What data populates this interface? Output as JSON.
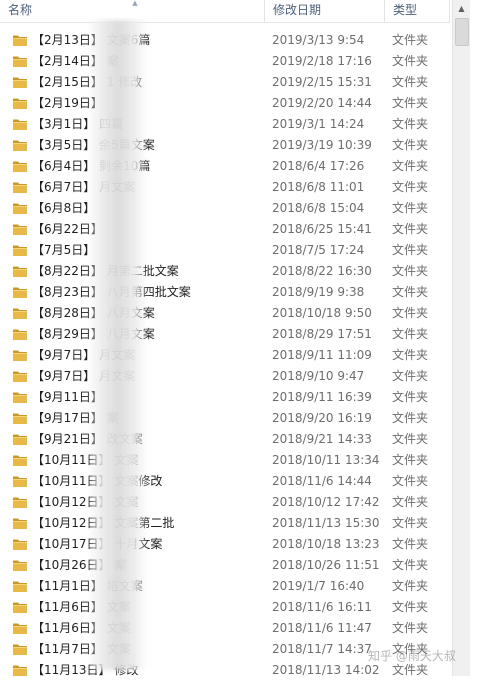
{
  "columns": {
    "name": "名称",
    "date": "修改日期",
    "type": "类型"
  },
  "rows": [
    {
      "name": "【2月13日】 文案6篇",
      "date": "2019/3/13 9:54",
      "type": "文件夹"
    },
    {
      "name": "【2月14日】 案",
      "date": "2019/2/18 17:16",
      "type": "文件夹"
    },
    {
      "name": "【2月15日】 1 修改",
      "date": "2019/2/15 15:31",
      "type": "文件夹"
    },
    {
      "name": "【2月19日】",
      "date": "2019/2/20 14:44",
      "type": "文件夹"
    },
    {
      "name": "【3月1日】 四篇",
      "date": "2019/3/1 14:24",
      "type": "文件夹"
    },
    {
      "name": "【3月5日】 余5篇文案",
      "date": "2019/3/19 10:39",
      "type": "文件夹"
    },
    {
      "name": "【6月4日】 剩余10篇",
      "date": "2018/6/4 17:26",
      "type": "文件夹"
    },
    {
      "name": "【6月7日】 月文案",
      "date": "2018/6/8 11:01",
      "type": "文件夹"
    },
    {
      "name": "【6月8日】",
      "date": "2018/6/8 15:04",
      "type": "文件夹"
    },
    {
      "name": "【6月22日】",
      "date": "2018/6/25 15:41",
      "type": "文件夹"
    },
    {
      "name": "【7月5日】",
      "date": "2018/7/5 17:24",
      "type": "文件夹"
    },
    {
      "name": "【8月22日】 月第二批文案",
      "date": "2018/8/22 16:30",
      "type": "文件夹"
    },
    {
      "name": "【8月23日】 八月第四批文案",
      "date": "2018/9/19 9:38",
      "type": "文件夹"
    },
    {
      "name": "【8月28日】 八月文案",
      "date": "2018/10/18 9:50",
      "type": "文件夹"
    },
    {
      "name": "【8月29日】 八月文案",
      "date": "2018/8/29 17:51",
      "type": "文件夹"
    },
    {
      "name": "【9月7日】 月文案",
      "date": "2018/9/11 11:09",
      "type": "文件夹"
    },
    {
      "name": "【9月7日】 月文案",
      "date": "2018/9/10 9:47",
      "type": "文件夹"
    },
    {
      "name": "【9月11日】",
      "date": "2018/9/11 16:39",
      "type": "文件夹"
    },
    {
      "name": "【9月17日】 案",
      "date": "2018/9/20 16:19",
      "type": "文件夹"
    },
    {
      "name": "【9月21日】 改文案",
      "date": "2018/9/21 14:33",
      "type": "文件夹"
    },
    {
      "name": "【10月11日】 文案",
      "date": "2018/10/11 13:34",
      "type": "文件夹"
    },
    {
      "name": "【10月11日】 文案修改",
      "date": "2018/11/6 14:44",
      "type": "文件夹"
    },
    {
      "name": "【10月12日】 文案",
      "date": "2018/10/12 17:42",
      "type": "文件夹"
    },
    {
      "name": "【10月12日】 文案第二批",
      "date": "2018/11/13 15:30",
      "type": "文件夹"
    },
    {
      "name": "【10月17日】 十月文案",
      "date": "2018/10/18 13:23",
      "type": "文件夹"
    },
    {
      "name": "【10月26日】 案",
      "date": "2018/10/26 11:51",
      "type": "文件夹"
    },
    {
      "name": "【11月1日】 培文案",
      "date": "2019/1/7 16:40",
      "type": "文件夹"
    },
    {
      "name": "【11月6日】 文案",
      "date": "2018/11/6 16:11",
      "type": "文件夹"
    },
    {
      "name": "【11月6日】 文案",
      "date": "2018/11/6 11:47",
      "type": "文件夹"
    },
    {
      "name": "【11月7日】 文案",
      "date": "2018/11/7 14:37",
      "type": "文件夹"
    },
    {
      "name": "【11月13日】 修改",
      "date": "2018/11/13 14:02",
      "type": "文件夹"
    }
  ],
  "watermark": "知乎 @雨天大叔",
  "colors": {
    "folder": "#e8b949",
    "folder_dark": "#c9982c",
    "header_text": "#4c607a"
  },
  "icons": {
    "folder": "folder-icon",
    "sort": "sort-up-icon",
    "scroll_up": "scroll-up-arrow-icon"
  }
}
